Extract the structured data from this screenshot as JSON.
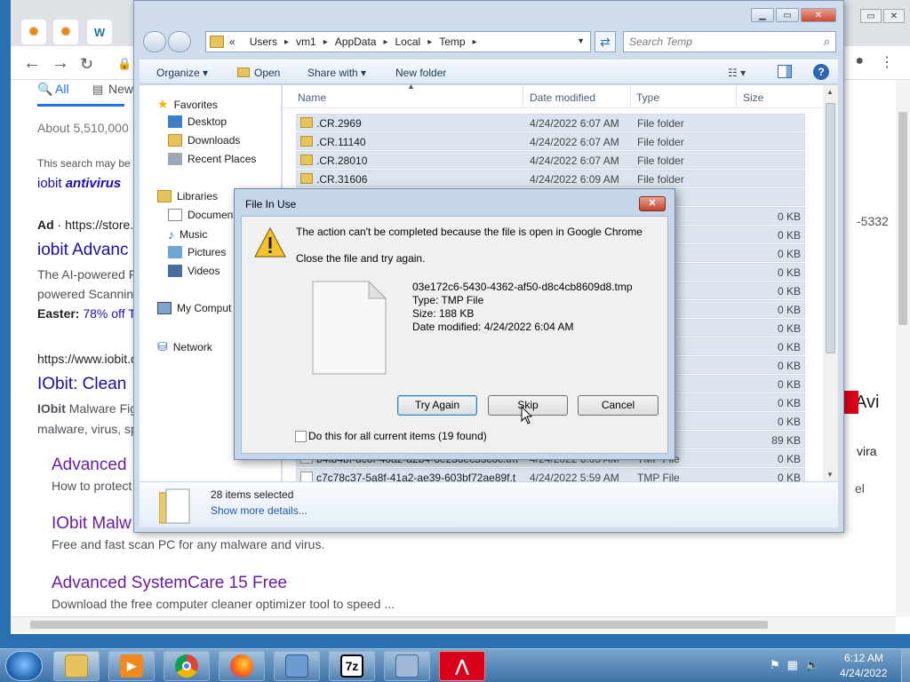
{
  "chrome": {
    "tab_fonts": [
      "WordPress"
    ],
    "search_tabs": {
      "all": "All",
      "news": "New"
    },
    "results_count": "About 5,510,000",
    "notice": "This search may be",
    "notice_link": "iobit",
    "notice_link_bold": "antivirus",
    "ad_label": "Ad",
    "ad_url": "https://store.",
    "ad_title": "iobit Advanc",
    "ad_snippet_1": "The AI-powered F",
    "ad_snippet_2": "powered Scannin",
    "ad_easter": "Easter:",
    "ad_offer": "78% off T",
    "ad_phone_tail": "-5332",
    "r1_url": "https://www.iobit.c",
    "r1_title": "IObit: Clean",
    "r1_snip_bold": "IObit",
    "r1_snip_1": " Malware Fig",
    "r1_snip_2": "malware, virus, sp",
    "sub1_title": "Advanced",
    "sub1_snip": "How to protect",
    "sub2_title": "IObit Malw",
    "sub2_snip": "Free and fast scan PC for any malware and virus.",
    "sub3_title": "Advanced SystemCare 15 Free",
    "sub3_snip": "Download the free computer cleaner optimizer tool to speed ...",
    "right_avira": "Avi",
    "right_vira": "vira",
    "right_el": "el"
  },
  "explorer": {
    "breadcrumb": [
      "Users",
      "vm1",
      "AppData",
      "Local",
      "Temp"
    ],
    "breadcrumb_prefix": "«",
    "search_placeholder": "Search Temp",
    "toolbar": {
      "organize": "Organize",
      "open": "Open",
      "share": "Share with",
      "new_folder": "New folder"
    },
    "nav": {
      "favorites": "Favorites",
      "desktop": "Desktop",
      "downloads": "Downloads",
      "recent": "Recent Places",
      "libraries": "Libraries",
      "documents": "Document",
      "music": "Music",
      "pictures": "Pictures",
      "videos": "Videos",
      "computer": "My Comput",
      "network": "Network"
    },
    "columns": {
      "name": "Name",
      "date": "Date modified",
      "type": "Type",
      "size": "Size"
    },
    "rows": [
      {
        "name": ".CR.2969",
        "date": "4/24/2022 6:07 AM",
        "type": "File folder",
        "size": "",
        "kind": "folder"
      },
      {
        "name": ".CR.11140",
        "date": "4/24/2022 6:07 AM",
        "type": "File folder",
        "size": "",
        "kind": "folder"
      },
      {
        "name": ".CR.28010",
        "date": "4/24/2022 6:07 AM",
        "type": "File folder",
        "size": "",
        "kind": "folder"
      },
      {
        "name": ".CR.31606",
        "date": "4/24/2022 6:09 AM",
        "type": "File folder",
        "size": "",
        "kind": "folder"
      },
      {
        "name": "",
        "date": "",
        "type": "er",
        "size": "",
        "kind": "file"
      },
      {
        "name": "",
        "date": "",
        "type": "",
        "size": "0 KB",
        "kind": "file"
      },
      {
        "name": "",
        "date": "",
        "type": "",
        "size": "0 KB",
        "kind": "file"
      },
      {
        "name": "",
        "date": "",
        "type": "",
        "size": "0 KB",
        "kind": "file"
      },
      {
        "name": "",
        "date": "",
        "type": "",
        "size": "0 KB",
        "kind": "file"
      },
      {
        "name": "",
        "date": "",
        "type": "",
        "size": "0 KB",
        "kind": "file"
      },
      {
        "name": "",
        "date": "",
        "type": "",
        "size": "0 KB",
        "kind": "file"
      },
      {
        "name": "",
        "date": "",
        "type": "",
        "size": "0 KB",
        "kind": "file"
      },
      {
        "name": "",
        "date": "",
        "type": "",
        "size": "0 KB",
        "kind": "file"
      },
      {
        "name": "",
        "date": "",
        "type": "",
        "size": "0 KB",
        "kind": "file"
      },
      {
        "name": "",
        "date": "",
        "type": "",
        "size": "0 KB",
        "kind": "file"
      },
      {
        "name": "",
        "date": "",
        "type": "",
        "size": "0 KB",
        "kind": "file"
      },
      {
        "name": "",
        "date": "",
        "type": "",
        "size": "0 KB",
        "kind": "file"
      },
      {
        "name": "",
        "date": "",
        "type": "cument",
        "size": "89 KB",
        "kind": "file"
      },
      {
        "name": "b4fb4bf-dc0f-40a2-a2b4-6e256ec53c0c.tm",
        "date": "4/24/2022 6:05 AM",
        "type": "TMP File",
        "size": "0 KB",
        "kind": "file"
      },
      {
        "name": "c7c78c37-5a8f-41a2-ae39-603bf72ae89f.t",
        "date": "4/24/2022 5:59 AM",
        "type": "TMP File",
        "size": "0 KB",
        "kind": "file"
      }
    ],
    "details": {
      "count": "28 items selected",
      "more": "Show more details..."
    }
  },
  "dialog": {
    "title": "File In Use",
    "close": "✕",
    "message": "The action can't be completed because the file is open in Google Chrome",
    "instruction": "Close the file and try again.",
    "file_name": "03e172c6-5430-4362-af50-d8c4cb8609d8.tmp",
    "file_type": "Type: TMP File",
    "file_size": "Size: 188 KB",
    "file_date": "Date modified: 4/24/2022 6:04 AM",
    "btn_try": "Try Again",
    "btn_skip": "Skip",
    "btn_cancel": "Cancel",
    "checkbox_label": "Do this for all current items (19 found)",
    "checkbox_checked": false
  },
  "taskbar": {
    "apps": [
      "file-explorer",
      "media-player",
      "chrome",
      "firefox",
      "control-panel",
      "7-zip",
      "network-tool",
      "avira"
    ],
    "app_7z": "7z",
    "time": "6:12 AM",
    "date": "4/24/2022"
  }
}
